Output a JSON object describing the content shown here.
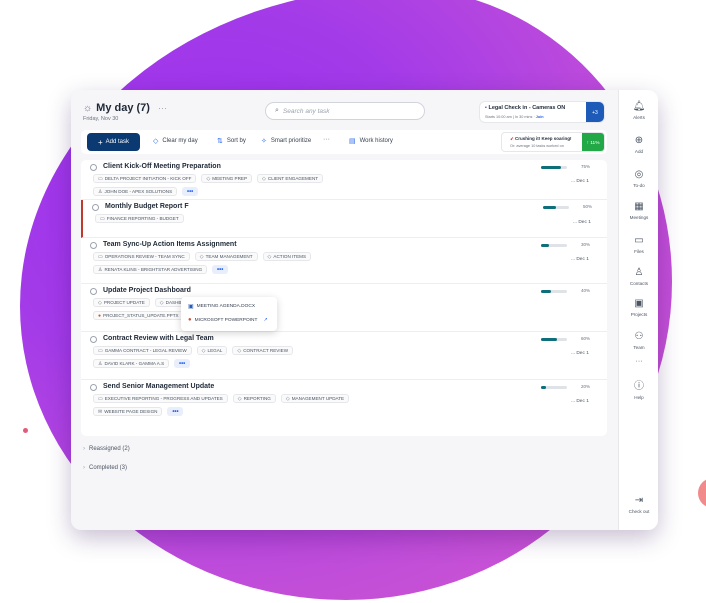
{
  "header": {
    "title": "My day (7)",
    "more": "···",
    "date": "Friday, Nov 30",
    "search_placeholder": "Search any task"
  },
  "notice": {
    "title": "Legal Check in - Cameras ON",
    "subtitle_prefix": "Starts 10:00 am | In 30 mins ·",
    "subtitle_link": "Join",
    "count": "+3"
  },
  "toolbar": {
    "add_task": "Add task",
    "clear_my_day": "Clear my day",
    "sort_by": "Sort by",
    "smart_prioritize": "Smart prioritize",
    "more": "···",
    "work_history": "Work history"
  },
  "streak": {
    "title": "Crushing it! Keep soaring!",
    "subtitle": "Or: average 10 tasks worked on",
    "percent": "↑ 11%"
  },
  "tasks": [
    {
      "name": "Client Kick-Off Meeting Preparation",
      "row1": [
        [
          "folder-icon",
          "DELTA PROJECT INITIATION - KICK OFF"
        ],
        [
          "tag-icon",
          "MEETING PREP"
        ],
        [
          "tag-icon",
          "CLIENT ENGAGEMENT"
        ]
      ],
      "row2": [
        [
          "person-icon",
          "JOHN DOE - APEX SOLUTIONS"
        ]
      ],
      "progress": 0.75,
      "percent": "75%",
      "due": "... Dec 1"
    },
    {
      "name": "Monthly Budget Report F",
      "row1": [
        [
          "folder-icon",
          "FINANCE REPORTING - BUDGET"
        ]
      ],
      "row2": [],
      "progress": 0.5,
      "percent": "50%",
      "due": "... Dec 1"
    },
    {
      "name": "Team Sync-Up Action Items Assignment",
      "row1": [
        [
          "folder-icon",
          "OPERATIONS REVIEW - TEAM SYNC"
        ],
        [
          "tag-icon",
          "TEAM MANAGEMENT"
        ],
        [
          "tag-icon",
          "ACTION ITEMS"
        ]
      ],
      "row2": [
        [
          "person-icon",
          "RENATA KLINS - BRIGHTSTAR ADVERTISING"
        ]
      ],
      "progress": 0.3,
      "percent": "30%",
      "due": "... Dec 1"
    },
    {
      "name": "Update Project Dashboard",
      "row1": [
        [
          "tag-icon",
          "PROJECT UPDATE"
        ],
        [
          "tag-icon",
          "DASHBOARD"
        ]
      ],
      "row2": [
        [
          "powerpoint-icon",
          "PROJECT_STATUS_UPDATE.PPTX"
        ]
      ],
      "progress": 0.4,
      "percent": "40%",
      "due": ""
    },
    {
      "name": "Contract Review with Legal Team",
      "row1": [
        [
          "folder-icon",
          "GAMMA CONTRACT - LEGAL REVIEW"
        ],
        [
          "tag-icon",
          "LEGAL"
        ],
        [
          "tag-icon",
          "CONTRACT REVIEW"
        ]
      ],
      "row2": [
        [
          "person-icon",
          "DAVID KLARK - GAMMA A.S"
        ]
      ],
      "progress": 0.6,
      "percent": "60%",
      "due": "... Dec 1"
    },
    {
      "name": "Send Senior Management Update",
      "row1": [
        [
          "folder-icon",
          "EXECUTIVE REPORTING - PROGRESS AND UPDATES"
        ],
        [
          "tag-icon",
          "REPORTING"
        ],
        [
          "tag-icon",
          "MANAGEMENT UPDATE"
        ]
      ],
      "row2": [
        [
          "mail-icon",
          "WEBSITE PAGE DESIGN"
        ]
      ],
      "progress": 0.2,
      "percent": "20%",
      "due": "... Dec 1"
    }
  ],
  "popup": {
    "item1": "MEETING AGENDA.DOCX",
    "item2": "MICROSOFT POWERPOINT"
  },
  "groups": {
    "reassigned": "Reassigned (2)",
    "completed": "Completed (3)"
  },
  "rail": {
    "alerts": "Alerts",
    "add": "Add",
    "todo": "To-do",
    "meetings": "Meetings",
    "files": "Files",
    "contacts": "Contacts",
    "projects": "Projects",
    "team": "Team",
    "more": "···",
    "help": "Help",
    "checkout": "Check out"
  },
  "colors": {
    "primary_button": "#0b3a72",
    "progress": "#0e6f7a",
    "streak": "#22a846",
    "background_blob": "#a33be8"
  }
}
